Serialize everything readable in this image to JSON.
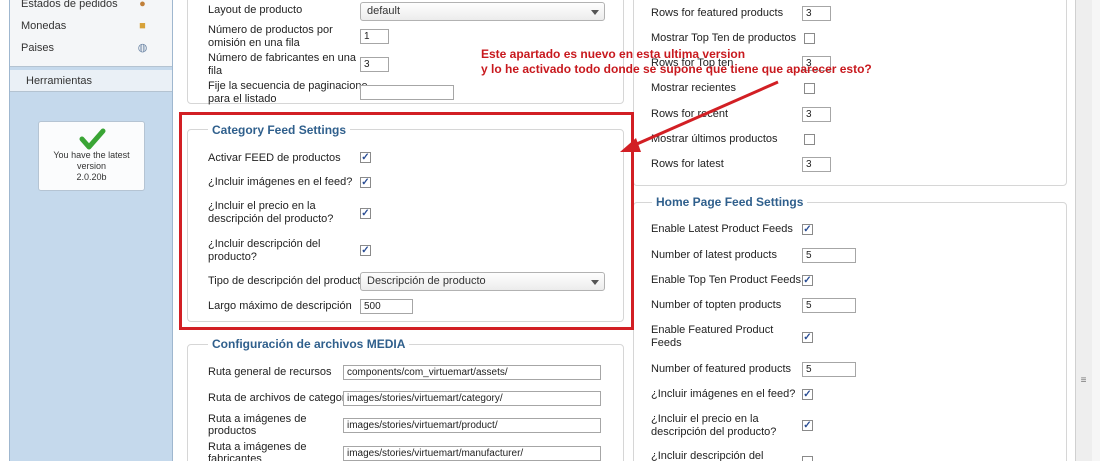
{
  "sidebar": {
    "items": [
      {
        "label": "Estados de pedidos",
        "icon": "order-status-icon"
      },
      {
        "label": "Monedas",
        "icon": "coins-icon"
      },
      {
        "label": "Paises",
        "icon": "globe-icon"
      }
    ],
    "tools_label": "Herramientas",
    "version_box": {
      "line1": "You have the latest",
      "line2": "version",
      "version": "2.0.20b"
    }
  },
  "top_left": {
    "layout_label": "Layout de producto",
    "layout_value": "default",
    "products_per_row_label_1": "Número de productos por",
    "products_per_row_label_2": "omisión en una fila",
    "products_per_row_value": "1",
    "manufacturers_per_row_label_1": "Número de fabricantes en una",
    "manufacturers_per_row_label_2": "fila",
    "manufacturers_per_row_value": "3",
    "pagination_label_1": "Fije la secuencia de paginacione",
    "pagination_label_2": "para el listado",
    "pagination_value": ""
  },
  "category_feed": {
    "legend": "Category Feed Settings",
    "activate_label": "Activar FEED de productos",
    "include_images_label": "¿Incluir imágenes en el feed?",
    "include_price_label_1": "¿Incluir el precio en la",
    "include_price_label_2": "descripción del producto?",
    "include_desc_label_1": "¿Incluir descripción del",
    "include_desc_label_2": "producto?",
    "desc_type_label": "Tipo de descripción del producto",
    "desc_type_value": "Descripción de producto",
    "max_len_label": "Largo máximo de descripción",
    "max_len_value": "500"
  },
  "media": {
    "legend": "Configuración de archivos MEDIA",
    "assets_label": "Ruta general de recursos",
    "assets_value": "components/com_virtuemart/assets/",
    "category_label": "Ruta de archivos de categoría",
    "category_value": "images/stories/virtuemart/category/",
    "product_label_1": "Ruta a imágenes de",
    "product_label_2": "productos",
    "product_value": "images/stories/virtuemart/product/",
    "manufacturer_label_1": "Ruta a imágenes de",
    "manufacturer_label_2": "fabricantes",
    "manufacturer_value": "images/stories/virtuemart/manufacturer/"
  },
  "top_right": {
    "rows_featured_label": "Rows for featured products",
    "rows_featured_value": "3",
    "show_topten_label": "Mostrar Top Ten de productos",
    "rows_topten_label": "Rows for Top ten",
    "rows_topten_value": "3",
    "show_recent_label": "Mostrar recientes",
    "rows_recent_label": "Rows for recent",
    "rows_recent_value": "3",
    "show_latest_label": "Mostrar últimos productos",
    "rows_latest_label": "Rows for latest",
    "rows_latest_value": "3"
  },
  "home_feed": {
    "legend": "Home Page Feed Settings",
    "enable_latest_label": "Enable Latest Product Feeds",
    "num_latest_label": "Number of latest products",
    "num_latest_value": "5",
    "enable_topten_label": "Enable Top Ten Product Feeds",
    "num_topten_label": "Number of topten products",
    "num_topten_value": "5",
    "enable_featured_label_1": "Enable Featured Product",
    "enable_featured_label_2": "Feeds",
    "num_featured_label": "Number of featured products",
    "num_featured_value": "5",
    "include_images_label": "¿Incluir imágenes en el feed?",
    "include_price_label_1": "¿Incluir el precio en la",
    "include_price_label_2": "descripción del producto?",
    "include_desc_label_1": "¿Incluir descripción del"
  },
  "annotation": {
    "line1": "Este apartado es nuevo en esta ultima version",
    "line2": "y lo he activado todo donde se supone que tiene que aparecer esto?"
  },
  "colors": {
    "annotation_red": "#d21f24",
    "legend_blue": "#2f5f8c",
    "sidebar_blue": "#c5d9ec"
  }
}
